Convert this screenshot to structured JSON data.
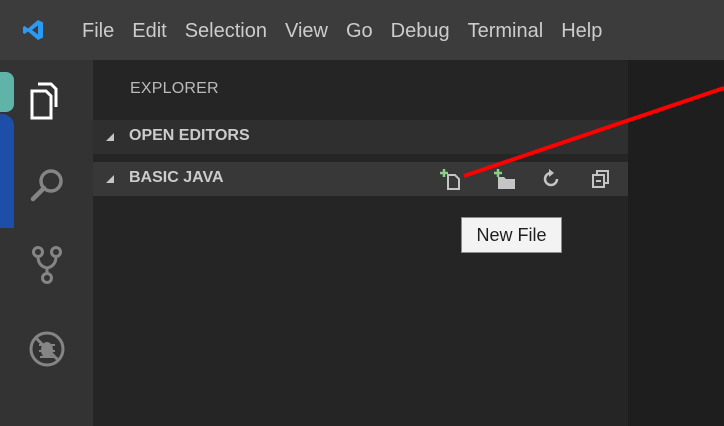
{
  "menu": {
    "items": [
      "File",
      "Edit",
      "Selection",
      "View",
      "Go",
      "Debug",
      "Terminal",
      "Help"
    ]
  },
  "activitybar": {
    "icons": [
      "explorer-icon",
      "search-icon",
      "source-control-icon",
      "debug-icon"
    ]
  },
  "sidebar": {
    "title": "EXPLORER",
    "sections": [
      {
        "label": "OPEN EDITORS",
        "expanded": true
      },
      {
        "label": "BASIC JAVA",
        "expanded": true
      }
    ],
    "toolbar": [
      "new-file-icon",
      "new-folder-icon",
      "refresh-icon",
      "collapse-all-icon"
    ]
  },
  "tooltip": {
    "text": "New File"
  },
  "colors": {
    "titlebar": "#3c3c3c",
    "activitybar": "#333333",
    "sidebar": "#252526",
    "editor": "#1e1e1e",
    "annotation_arrow": "#ff0000",
    "vscode_blue": "#2b9af3"
  }
}
